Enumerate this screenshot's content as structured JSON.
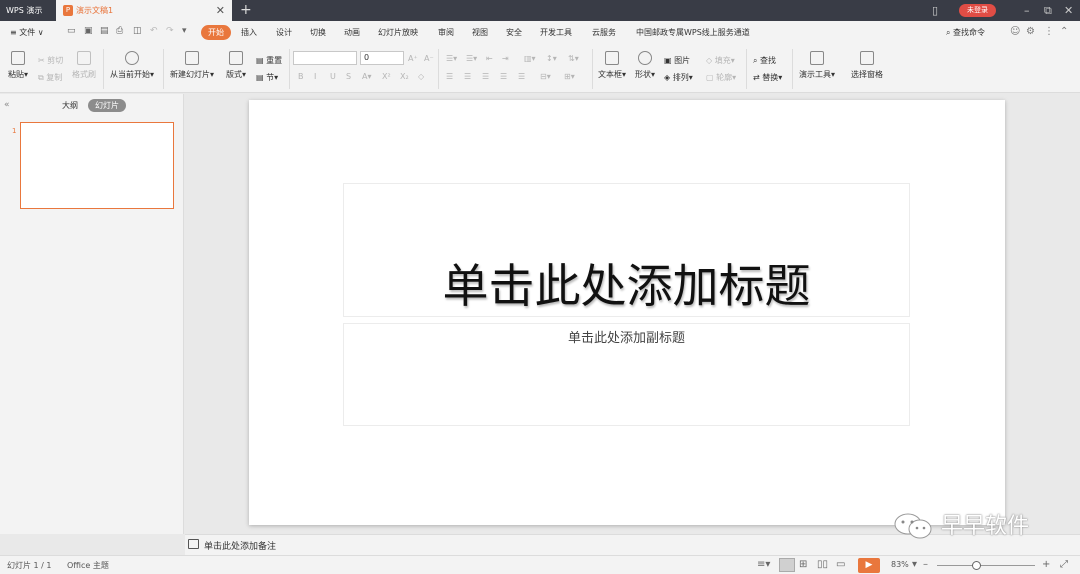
{
  "titlebar": {
    "app_name": "WPS 演示",
    "doc_tab": "演示文稿1",
    "close": "✕",
    "new_tab": "+",
    "login": "未登录"
  },
  "menubar": {
    "file": "≡ 文件 ∨",
    "tabs": [
      "开始",
      "插入",
      "设计",
      "切换",
      "动画",
      "幻灯片放映",
      "审阅",
      "视图",
      "安全",
      "开发工具",
      "云服务",
      "中国邮政专属WPS线上服务通道"
    ],
    "active_tab": "开始",
    "search": "查找命令"
  },
  "ribbon": {
    "paste": "粘贴",
    "cut": "剪切",
    "copy": "复制",
    "format_painter": "格式刷",
    "from_current": "从当前开始",
    "new_slide": "新建幻灯片",
    "layout": "版式",
    "reset": "重置",
    "section": "节",
    "font_size": "0",
    "textbox": "文本框",
    "shape": "形状",
    "picture": "图片",
    "arrange": "排列",
    "fill": "填充",
    "outline": "轮廓",
    "find": "查找",
    "replace": "替换",
    "presenter_tools": "演示工具",
    "select_pane": "选择窗格"
  },
  "leftpanel": {
    "outline_tab": "大纲",
    "slides_tab": "幻灯片",
    "slide_number": "1"
  },
  "slide": {
    "title_placeholder": "单击此处添加标题",
    "subtitle_placeholder": "单击此处添加副标题"
  },
  "notes": {
    "placeholder": "单击此处添加备注"
  },
  "statusbar": {
    "slide_info": "幻灯片 1 / 1",
    "theme": "Office 主题",
    "zoom": "83%"
  },
  "zoom_level": 0.83,
  "watermark": {
    "text": "早早软件"
  },
  "colors": {
    "accent": "#e9773d",
    "titlebar": "#393c46",
    "login": "#e04d45"
  }
}
